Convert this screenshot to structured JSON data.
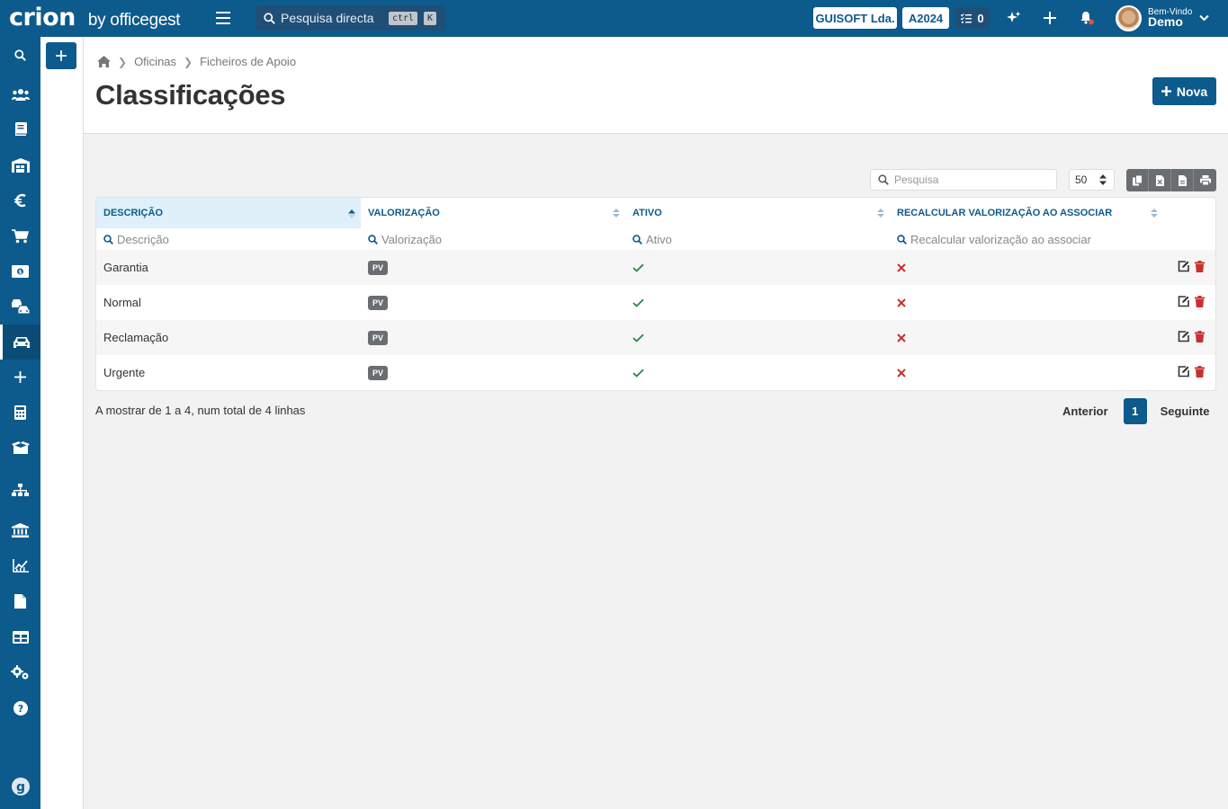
{
  "app": {
    "logo_mark": "crion",
    "logo_sub": "by officegest"
  },
  "topbar": {
    "search_placeholder": "Pesquisa directa",
    "shortcut_ctrl": "ctrl",
    "shortcut_key": "K",
    "company": "GUISOFT Lda.",
    "year": "A2024",
    "tasks_count": "0",
    "welcome": "Bem-Vindo",
    "user": "Demo",
    "icons": [
      "sparkle-icon",
      "plus-icon",
      "bell-icon",
      "chevron-down-icon"
    ]
  },
  "sidebar": {
    "items": [
      {
        "icon": "search-icon"
      },
      {
        "icon": "users-icon"
      },
      {
        "icon": "book-icon"
      },
      {
        "icon": "warehouse-icon"
      },
      {
        "icon": "euro-icon"
      },
      {
        "icon": "cart-icon"
      },
      {
        "icon": "money-icon"
      },
      {
        "icon": "cars-icon"
      },
      {
        "icon": "car-icon",
        "active": true
      },
      {
        "icon": "plus-icon"
      },
      {
        "icon": "calculator-icon"
      },
      {
        "icon": "box-icon"
      },
      {
        "icon": "sitemap-icon"
      },
      {
        "icon": "bank-icon"
      },
      {
        "icon": "chart-icon"
      },
      {
        "icon": "file-icon"
      },
      {
        "icon": "table-icon"
      },
      {
        "icon": "cogs-icon"
      },
      {
        "icon": "help-icon"
      },
      {
        "icon": "officegest-icon"
      }
    ]
  },
  "breadcrumb": {
    "items": [
      "Oficinas",
      "Ficheiros de Apoio"
    ]
  },
  "page": {
    "title": "Classificações",
    "new_label": "Nova"
  },
  "table_controls": {
    "search_placeholder": "Pesquisa",
    "page_size": "50"
  },
  "table": {
    "columns": [
      "DESCRIÇÃO",
      "VALORIZAÇÃO",
      "ATIVO",
      "RECALCULAR VALORIZAÇÃO AO ASSOCIAR"
    ],
    "filters": [
      "Descrição",
      "Valorização",
      "Ativo",
      "Recalcular valorização ao associar"
    ],
    "rows": [
      {
        "descricao": "Garantia",
        "valorizacao": "PV",
        "ativo": true,
        "recalcular": false
      },
      {
        "descricao": "Normal",
        "valorizacao": "PV",
        "ativo": true,
        "recalcular": false
      },
      {
        "descricao": "Reclamação",
        "valorizacao": "PV",
        "ativo": true,
        "recalcular": false
      },
      {
        "descricao": "Urgente",
        "valorizacao": "PV",
        "ativo": true,
        "recalcular": false
      }
    ]
  },
  "footer": {
    "info": "A mostrar de 1 a 4, num total de 4 linhas",
    "previous": "Anterior",
    "current_page": "1",
    "next": "Seguinte"
  },
  "colors": {
    "brand": "#0d5a8c",
    "check": "#28834a",
    "cross": "#c9302c",
    "delete": "#c9302c"
  }
}
